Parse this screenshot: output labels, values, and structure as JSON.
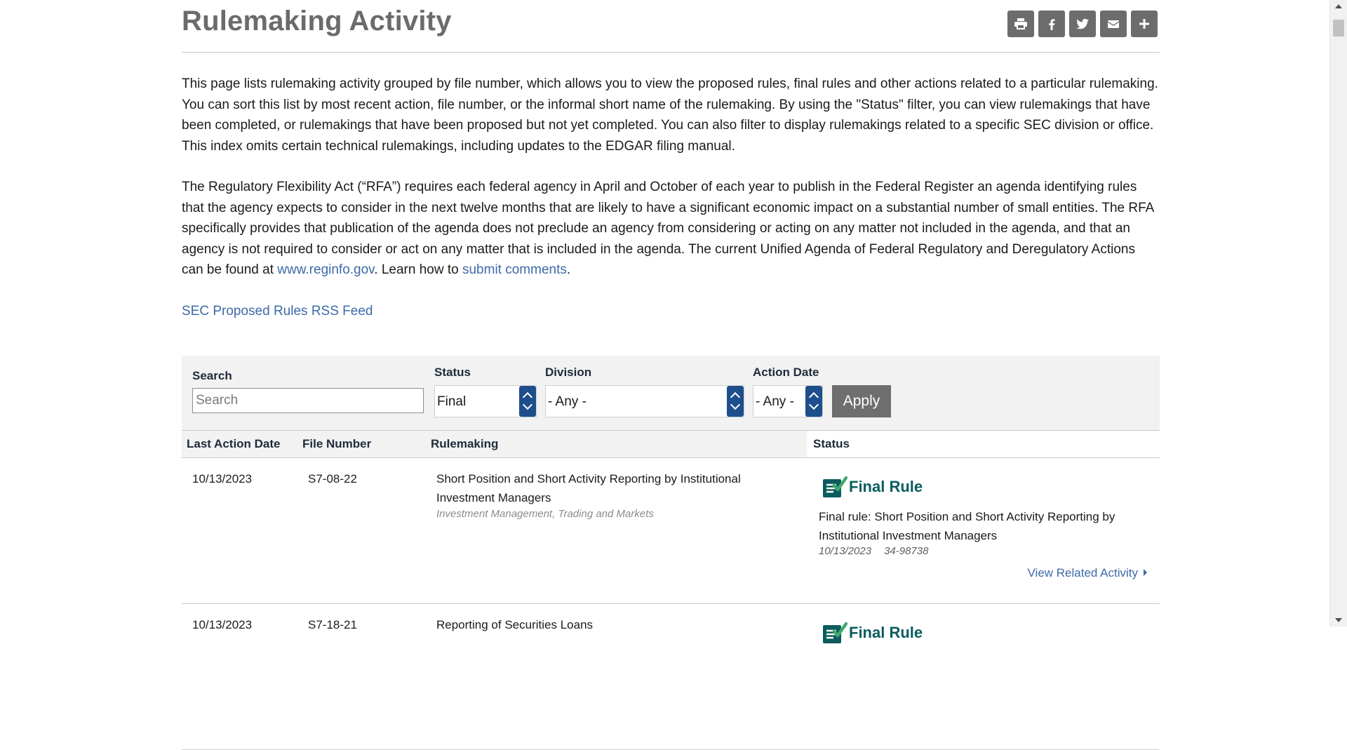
{
  "page": {
    "title": "Rulemaking Activity",
    "share_icons": [
      "print-icon",
      "facebook-icon",
      "twitter-icon",
      "email-icon",
      "plus-icon"
    ]
  },
  "intro": {
    "p1": "This page lists rulemaking activity grouped by file number, which allows you to view the proposed rules, final rules and other actions related to a particular rulemaking. You can sort this list by most recent action, file number, or the informal short name of the rulemaking. By using the \"Status\" filter, you can view rulemakings that have been completed, or rulemakings that have been proposed but not yet completed. You can also filter to display rulemakings related to a specific SEC division or office. This index omits certain technical rulemakings, including updates to the EDGAR filing manual.",
    "p2_before": "The Regulatory Flexibility Act (“RFA”) requires each federal agency in April and October of each year to publish in the Federal Register an agenda identifying rules that the agency expects to consider in the next twelve months that are likely to have a significant economic impact on a substantial number of small entities. The RFA specifically provides that publication of the agenda does not preclude an agency from considering or acting on any matter not included in the agenda, and that an agency is not required to consider or act on any matter that is included in the agenda. The current Unified Agenda of Federal Regulatory and Deregulatory Actions can be found at ",
    "p2_link1": "www.reginfo.gov",
    "p2_middle": ". Learn how to ",
    "p2_link2": "submit comments",
    "p2_after": ".",
    "rss_link": "SEC Proposed Rules RSS Feed"
  },
  "filters": {
    "search_label": "Search",
    "search_placeholder": "Search",
    "status_label": "Status",
    "status_value": "Final",
    "division_label": "Division",
    "division_value": "- Any -",
    "action_date_label": "Action Date",
    "action_date_value": "- Any -",
    "apply_label": "Apply"
  },
  "table": {
    "headers": [
      "Last Action Date",
      "File Number",
      "Rulemaking",
      "Status"
    ],
    "rows": [
      {
        "date": "10/13/2023",
        "file_number": "S7-08-22",
        "rulemaking": "Short Position and Short Activity Reporting by Institutional Investment Managers",
        "divisions": "Investment Management, Trading and Markets",
        "status_label": "Final Rule",
        "status_desc": "Final rule: Short Position and Short Activity Reporting by Institutional Investment Managers",
        "status_date": "10/13/2023",
        "release_number": "34-98738",
        "related_link": "View Related Activity"
      },
      {
        "date": "10/13/2023",
        "file_number": "S7-18-21",
        "rulemaking": "Reporting of Securities Loans",
        "status_label": "Final Rule"
      }
    ]
  },
  "colors": {
    "accent_blue": "#1f4e8c",
    "link_blue": "#3d6aa8",
    "status_teal": "#0a5c5e",
    "button_gray": "#6c6c6c"
  }
}
